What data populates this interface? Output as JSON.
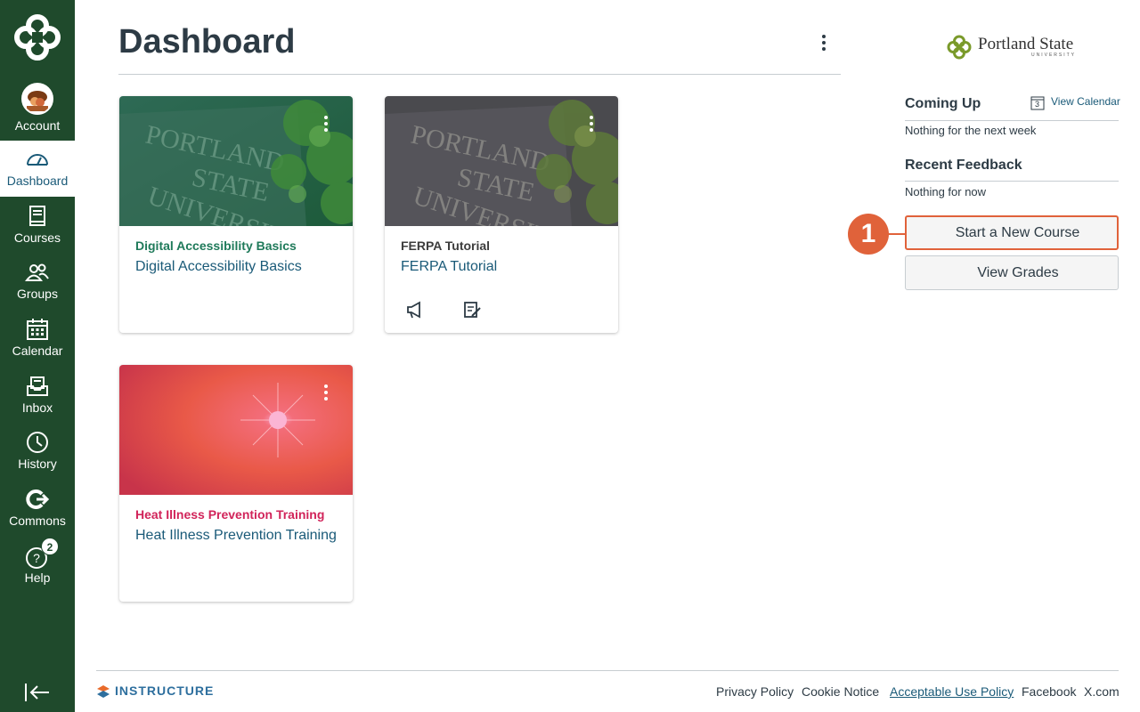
{
  "nav": {
    "account": "Account",
    "dashboard": "Dashboard",
    "courses": "Courses",
    "groups": "Groups",
    "calendar": "Calendar",
    "inbox": "Inbox",
    "history": "History",
    "commons": "Commons",
    "help": "Help",
    "help_badge": "2"
  },
  "page": {
    "title": "Dashboard"
  },
  "cards": [
    {
      "subtitle": "Digital Accessibility Basics",
      "name": "Digital Accessibility Basics",
      "color": "#1f7a5a"
    },
    {
      "subtitle": "FERPA Tutorial",
      "name": "FERPA Tutorial",
      "color": "#3d3d3d"
    },
    {
      "subtitle": "Heat Illness Prevention Training",
      "name": "Heat Illness Prevention Training",
      "color": "#d1245a"
    }
  ],
  "sidebar": {
    "brand_main": "Portland State",
    "brand_sub": "UNIVERSITY",
    "coming_up": "Coming Up",
    "view_calendar": "View Calendar",
    "calendar_day": "3",
    "coming_up_empty": "Nothing for the next week",
    "recent_feedback": "Recent Feedback",
    "recent_feedback_empty": "Nothing for now",
    "start_course": "Start a New Course",
    "view_grades": "View Grades",
    "callout_number": "1"
  },
  "footer": {
    "brand": "INSTRUCTURE",
    "links": [
      "Privacy Policy",
      "Cookie Notice",
      "Acceptable Use Policy",
      "Facebook",
      "X.com"
    ]
  },
  "colors": {
    "nav_bg": "#1f4a2c",
    "link": "#1a5a78",
    "callout": "#e0623a"
  }
}
